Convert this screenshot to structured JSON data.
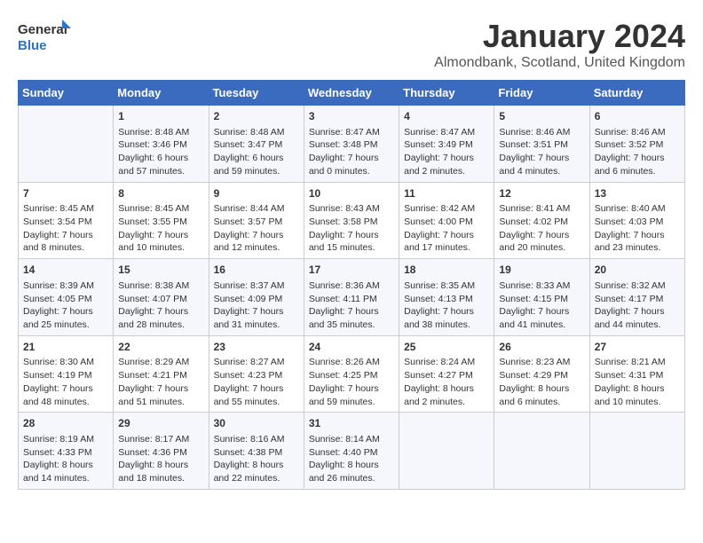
{
  "logo": {
    "general": "General",
    "blue": "Blue"
  },
  "calendar": {
    "title": "January 2024",
    "subtitle": "Almondbank, Scotland, United Kingdom"
  },
  "weekdays": [
    "Sunday",
    "Monday",
    "Tuesday",
    "Wednesday",
    "Thursday",
    "Friday",
    "Saturday"
  ],
  "weeks": [
    [
      {
        "day": "",
        "sunrise": "",
        "sunset": "",
        "daylight": ""
      },
      {
        "day": "1",
        "sunrise": "Sunrise: 8:48 AM",
        "sunset": "Sunset: 3:46 PM",
        "daylight": "Daylight: 6 hours and 57 minutes."
      },
      {
        "day": "2",
        "sunrise": "Sunrise: 8:48 AM",
        "sunset": "Sunset: 3:47 PM",
        "daylight": "Daylight: 6 hours and 59 minutes."
      },
      {
        "day": "3",
        "sunrise": "Sunrise: 8:47 AM",
        "sunset": "Sunset: 3:48 PM",
        "daylight": "Daylight: 7 hours and 0 minutes."
      },
      {
        "day": "4",
        "sunrise": "Sunrise: 8:47 AM",
        "sunset": "Sunset: 3:49 PM",
        "daylight": "Daylight: 7 hours and 2 minutes."
      },
      {
        "day": "5",
        "sunrise": "Sunrise: 8:46 AM",
        "sunset": "Sunset: 3:51 PM",
        "daylight": "Daylight: 7 hours and 4 minutes."
      },
      {
        "day": "6",
        "sunrise": "Sunrise: 8:46 AM",
        "sunset": "Sunset: 3:52 PM",
        "daylight": "Daylight: 7 hours and 6 minutes."
      }
    ],
    [
      {
        "day": "7",
        "sunrise": "Sunrise: 8:45 AM",
        "sunset": "Sunset: 3:54 PM",
        "daylight": "Daylight: 7 hours and 8 minutes."
      },
      {
        "day": "8",
        "sunrise": "Sunrise: 8:45 AM",
        "sunset": "Sunset: 3:55 PM",
        "daylight": "Daylight: 7 hours and 10 minutes."
      },
      {
        "day": "9",
        "sunrise": "Sunrise: 8:44 AM",
        "sunset": "Sunset: 3:57 PM",
        "daylight": "Daylight: 7 hours and 12 minutes."
      },
      {
        "day": "10",
        "sunrise": "Sunrise: 8:43 AM",
        "sunset": "Sunset: 3:58 PM",
        "daylight": "Daylight: 7 hours and 15 minutes."
      },
      {
        "day": "11",
        "sunrise": "Sunrise: 8:42 AM",
        "sunset": "Sunset: 4:00 PM",
        "daylight": "Daylight: 7 hours and 17 minutes."
      },
      {
        "day": "12",
        "sunrise": "Sunrise: 8:41 AM",
        "sunset": "Sunset: 4:02 PM",
        "daylight": "Daylight: 7 hours and 20 minutes."
      },
      {
        "day": "13",
        "sunrise": "Sunrise: 8:40 AM",
        "sunset": "Sunset: 4:03 PM",
        "daylight": "Daylight: 7 hours and 23 minutes."
      }
    ],
    [
      {
        "day": "14",
        "sunrise": "Sunrise: 8:39 AM",
        "sunset": "Sunset: 4:05 PM",
        "daylight": "Daylight: 7 hours and 25 minutes."
      },
      {
        "day": "15",
        "sunrise": "Sunrise: 8:38 AM",
        "sunset": "Sunset: 4:07 PM",
        "daylight": "Daylight: 7 hours and 28 minutes."
      },
      {
        "day": "16",
        "sunrise": "Sunrise: 8:37 AM",
        "sunset": "Sunset: 4:09 PM",
        "daylight": "Daylight: 7 hours and 31 minutes."
      },
      {
        "day": "17",
        "sunrise": "Sunrise: 8:36 AM",
        "sunset": "Sunset: 4:11 PM",
        "daylight": "Daylight: 7 hours and 35 minutes."
      },
      {
        "day": "18",
        "sunrise": "Sunrise: 8:35 AM",
        "sunset": "Sunset: 4:13 PM",
        "daylight": "Daylight: 7 hours and 38 minutes."
      },
      {
        "day": "19",
        "sunrise": "Sunrise: 8:33 AM",
        "sunset": "Sunset: 4:15 PM",
        "daylight": "Daylight: 7 hours and 41 minutes."
      },
      {
        "day": "20",
        "sunrise": "Sunrise: 8:32 AM",
        "sunset": "Sunset: 4:17 PM",
        "daylight": "Daylight: 7 hours and 44 minutes."
      }
    ],
    [
      {
        "day": "21",
        "sunrise": "Sunrise: 8:30 AM",
        "sunset": "Sunset: 4:19 PM",
        "daylight": "Daylight: 7 hours and 48 minutes."
      },
      {
        "day": "22",
        "sunrise": "Sunrise: 8:29 AM",
        "sunset": "Sunset: 4:21 PM",
        "daylight": "Daylight: 7 hours and 51 minutes."
      },
      {
        "day": "23",
        "sunrise": "Sunrise: 8:27 AM",
        "sunset": "Sunset: 4:23 PM",
        "daylight": "Daylight: 7 hours and 55 minutes."
      },
      {
        "day": "24",
        "sunrise": "Sunrise: 8:26 AM",
        "sunset": "Sunset: 4:25 PM",
        "daylight": "Daylight: 7 hours and 59 minutes."
      },
      {
        "day": "25",
        "sunrise": "Sunrise: 8:24 AM",
        "sunset": "Sunset: 4:27 PM",
        "daylight": "Daylight: 8 hours and 2 minutes."
      },
      {
        "day": "26",
        "sunrise": "Sunrise: 8:23 AM",
        "sunset": "Sunset: 4:29 PM",
        "daylight": "Daylight: 8 hours and 6 minutes."
      },
      {
        "day": "27",
        "sunrise": "Sunrise: 8:21 AM",
        "sunset": "Sunset: 4:31 PM",
        "daylight": "Daylight: 8 hours and 10 minutes."
      }
    ],
    [
      {
        "day": "28",
        "sunrise": "Sunrise: 8:19 AM",
        "sunset": "Sunset: 4:33 PM",
        "daylight": "Daylight: 8 hours and 14 minutes."
      },
      {
        "day": "29",
        "sunrise": "Sunrise: 8:17 AM",
        "sunset": "Sunset: 4:36 PM",
        "daylight": "Daylight: 8 hours and 18 minutes."
      },
      {
        "day": "30",
        "sunrise": "Sunrise: 8:16 AM",
        "sunset": "Sunset: 4:38 PM",
        "daylight": "Daylight: 8 hours and 22 minutes."
      },
      {
        "day": "31",
        "sunrise": "Sunrise: 8:14 AM",
        "sunset": "Sunset: 4:40 PM",
        "daylight": "Daylight: 8 hours and 26 minutes."
      },
      {
        "day": "",
        "sunrise": "",
        "sunset": "",
        "daylight": ""
      },
      {
        "day": "",
        "sunrise": "",
        "sunset": "",
        "daylight": ""
      },
      {
        "day": "",
        "sunrise": "",
        "sunset": "",
        "daylight": ""
      }
    ]
  ]
}
